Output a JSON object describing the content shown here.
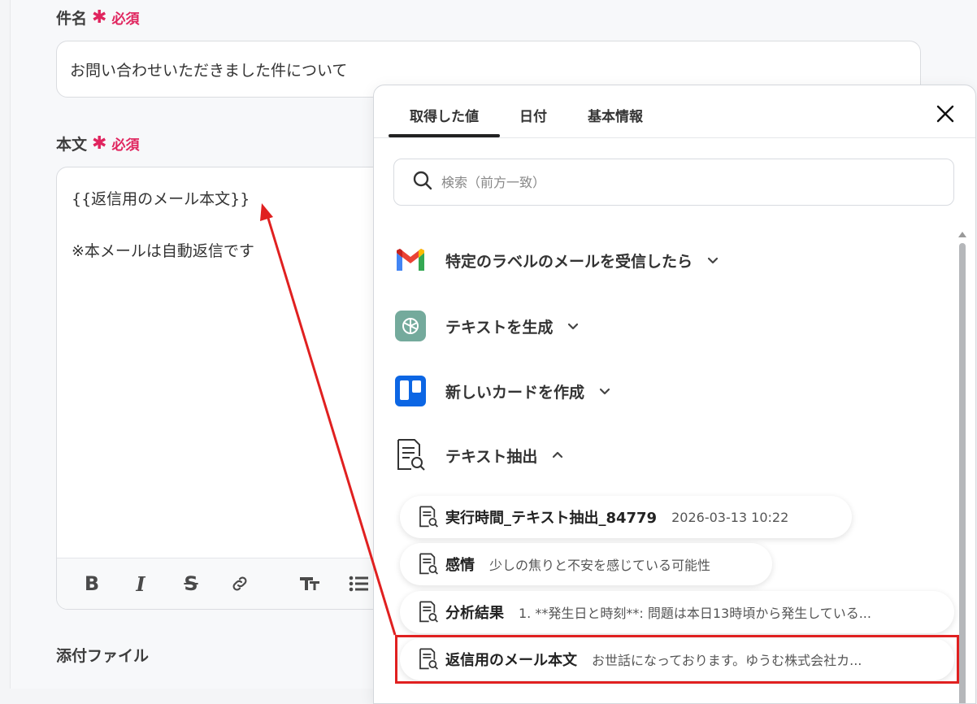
{
  "form": {
    "subject_label": "件名",
    "required_mark": "✱",
    "required_text": "必須",
    "subject_value": "お問い合わせいただきました件について",
    "body_label": "本文",
    "body_line1": "{{返信用のメール本文}}",
    "body_line2": "※本メールは自動返信です",
    "attachment_label": "添付ファイル"
  },
  "panel": {
    "tabs": [
      "取得した値",
      "日付",
      "基本情報"
    ],
    "search_placeholder": "検索（前方一致）",
    "groups": [
      {
        "label": "特定のラベルのメールを受信したら",
        "icon": "gmail-icon",
        "expanded": false
      },
      {
        "label": "テキストを生成",
        "icon": "chatgpt-icon",
        "expanded": false
      },
      {
        "label": "新しいカードを作成",
        "icon": "trello-icon",
        "expanded": false
      },
      {
        "label": "テキスト抽出",
        "icon": "document-search-icon",
        "expanded": true
      }
    ],
    "items": [
      {
        "name": "実行時間_テキスト抽出_84779",
        "value": "2026-03-13 10:22"
      },
      {
        "name": "感情",
        "value": "少しの焦りと不安を感じている可能性"
      },
      {
        "name": "分析結果",
        "value": "1. **発生日と時刻**: 問題は本日13時頃から発生している..."
      },
      {
        "name": "返信用のメール本文",
        "value": "お世話になっております。ゆうむ株式会社カ..."
      }
    ]
  },
  "colors": {
    "required": "#e0245e",
    "highlight": "#e02020"
  }
}
